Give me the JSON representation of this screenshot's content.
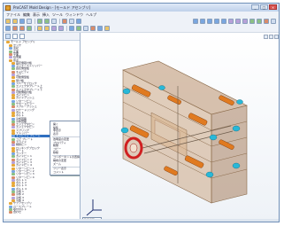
{
  "window": {
    "title": "ProCAST Mold Design - [モールド アセンブリ]",
    "minimize": "_",
    "maximize": "□",
    "close": "×"
  },
  "menu": [
    "ファイル",
    "編集",
    "表示",
    "挿入",
    "ツール",
    "ウィンドウ",
    "ヘルプ"
  ],
  "tree": {
    "root_label": "モールド アセンブリ",
    "selected_label": "キャビティ プレート",
    "items": [
      "センサ",
      "注記",
      "正面",
      "平面",
      "右側面",
      "原点",
      "固定側取付板",
      "ランナーストリッパー",
      "固定側型板",
      "キャビティ",
      "コア",
      "可動側型板",
      "受け板",
      "スペーサブロック",
      "エジェクタプレート上",
      "エジェクタプレート下",
      "可動側取付板",
      "ガイドピン",
      "ガイドブッシュ",
      "リターンピン",
      "サポートピラー",
      "スプルーブッシュ",
      "ロケートリング",
      "ボルト",
      "ボルト",
      "冷却回路",
      "冷却回路",
      "エジェクタピン",
      "エジェクタピン",
      "スプリング",
      "ストッパー",
      "キャビティ プレート",
      "コア プレート",
      "スライド",
      "傾斜ピン",
      "ロッキングブロック",
      "ゲート",
      "ランナー",
      "ガイドピン 1",
      "ガイドピン 2",
      "ガイドピン 3",
      "ガイドピン 4",
      "リターンピン 1",
      "リターンピン 2",
      "リターンピン 3",
      "リターンピン 4",
      "ボルト 1",
      "ボルト 2",
      "ボルト 3",
      "ボルト 4",
      "冷却 1",
      "冷却 2",
      "冷却 3",
      "冷却 4",
      "サブアセンブリ",
      "ベースプレート",
      "取付ボルト",
      "合わせ"
    ]
  },
  "context_menu": {
    "items": [
      "開く",
      "編集",
      "非表示",
      "表示",
      "透明度の変更",
      "プロパティ",
      "削除",
      "コピー",
      "移動",
      "コンポーネントの置換",
      "構成の変更",
      "ズーム",
      "ツリー表示",
      "コメント"
    ]
  },
  "view": {
    "zoom_label": "等角投影"
  },
  "colors": {
    "mold_body": "#c89f7a",
    "mold_edge": "#8a6a4a",
    "rod_orange": "#e07a20",
    "rod_cyan": "#28b8d8",
    "ring_red": "#d02020",
    "selection": "#2f6fc0"
  },
  "icons": [
    "app-icon",
    "folder-icon",
    "part-icon",
    "triad-icon"
  ]
}
